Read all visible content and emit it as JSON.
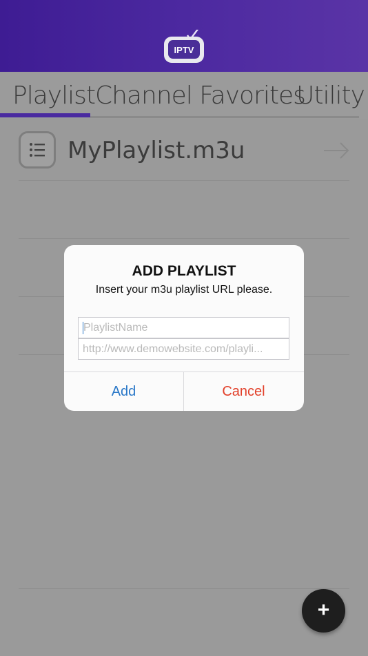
{
  "header": {
    "logo_text": "IPTV",
    "brand_color": "#4a2aa0"
  },
  "tabs": [
    {
      "label": "Playlist",
      "active": true
    },
    {
      "label": "Channel Favorites",
      "active": false
    },
    {
      "label": "Utility",
      "active": false
    }
  ],
  "playlist": {
    "items": [
      {
        "name": "MyPlaylist.m3u",
        "icon": "list-icon",
        "action_icon": "arrow-right-icon"
      }
    ]
  },
  "dialog": {
    "title": "ADD PLAYLIST",
    "message": "Insert your m3u playlist URL please.",
    "name_field": {
      "placeholder": "PlaylistName",
      "value": ""
    },
    "url_field": {
      "placeholder": "http://www.demowebsite.com/playli...",
      "value": ""
    },
    "add_label": "Add",
    "cancel_label": "Cancel",
    "add_color": "#2a78c8",
    "cancel_color": "#e2402a"
  },
  "fab": {
    "label": "+",
    "icon": "plus-icon"
  }
}
